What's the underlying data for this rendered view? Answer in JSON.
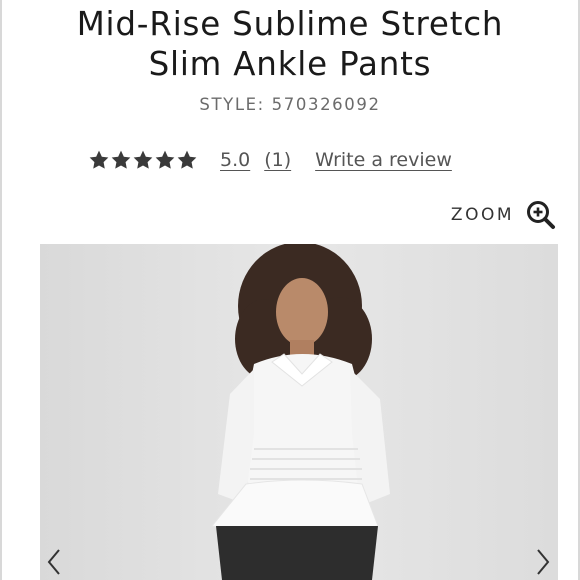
{
  "product": {
    "title_line1": "Mid-Rise Sublime Stretch",
    "title_line2": "Slim Ankle Pants",
    "style_label": "STYLE: 570326092"
  },
  "rating": {
    "stars": 5,
    "value": "5.0",
    "count": "(1)",
    "write_review": "Write a review"
  },
  "zoom": {
    "label": "ZOOM",
    "icon": "zoom-in-icon"
  },
  "image": {
    "alt": "product-photo"
  },
  "colors": {
    "text": "#1a1a1a",
    "muted": "#6b6b6b",
    "star": "#3a3a3a"
  }
}
